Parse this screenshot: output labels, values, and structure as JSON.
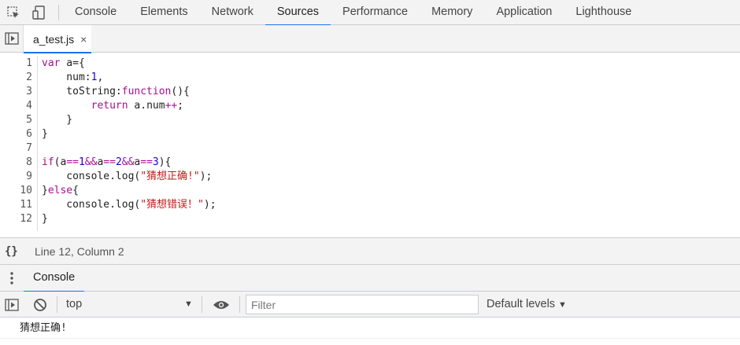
{
  "topbar": {
    "tabs": [
      {
        "label": "Console",
        "active": false
      },
      {
        "label": "Elements",
        "active": false
      },
      {
        "label": "Network",
        "active": false
      },
      {
        "label": "Sources",
        "active": true
      },
      {
        "label": "Performance",
        "active": false
      },
      {
        "label": "Memory",
        "active": false
      },
      {
        "label": "Application",
        "active": false
      },
      {
        "label": "Lighthouse",
        "active": false
      }
    ],
    "icons": [
      "inspect-element-icon",
      "device-toolbar-icon"
    ]
  },
  "editor": {
    "file_tab": "a_test.js",
    "close_glyph": "×",
    "line_numbers": [
      "1",
      "2",
      "3",
      "4",
      "5",
      "6",
      "7",
      "8",
      "9",
      "10",
      "11",
      "12"
    ]
  },
  "status": {
    "pretty_print": "{}",
    "cursor_position": "Line 12, Column 2"
  },
  "drawer": {
    "tab": "Console"
  },
  "console": {
    "context": "top",
    "filter_placeholder": "Filter",
    "levels": "Default levels",
    "output": "猜想正确!"
  },
  "colors": {
    "accent": "#1a73e8",
    "keyword": "#aa0d91",
    "number": "#1c00cf",
    "string": "#c41a16",
    "toolbar_bg": "#f3f3f3"
  }
}
